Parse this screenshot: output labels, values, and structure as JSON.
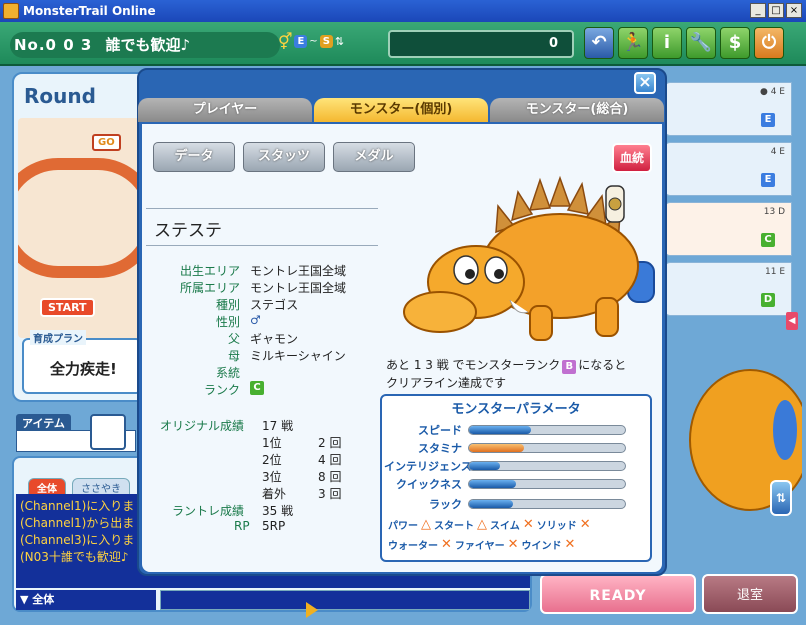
{
  "window": {
    "title": "MonsterTrail Online",
    "min_label": "_",
    "max_label": "□",
    "close_label": "×"
  },
  "topbar": {
    "room_number": "No.0 0 3",
    "room_name": "誰でも歓迎♪",
    "room_chip_e": "E",
    "room_chip_sep": "~",
    "room_chip_s": "S",
    "points": "0",
    "tool_icons": [
      "back-arrow-icon",
      "runner-icon",
      "info-icon",
      "wrench-icon",
      "money-bag-icon",
      "power-icon"
    ]
  },
  "left": {
    "round_label": "Round",
    "goal_label": "GO",
    "start_label": "START",
    "plan_title": "育成プラン",
    "plan_value": "全力疾走!",
    "item_tab": "アイテム"
  },
  "chat": {
    "tabs": [
      "全体",
      "ささやき"
    ],
    "log": [
      "(Channel1)に入りまし",
      "(Channel1)から出まし",
      "(Channel3)に入りまし",
      "(N03十誰でも歓迎♪"
    ],
    "scope": "全体"
  },
  "right_slots": [
    {
      "badge": "● 4 E",
      "rank": "E"
    },
    {
      "badge": "4 E",
      "rank": "E"
    },
    {
      "badge": "13 D",
      "rank": "C"
    },
    {
      "badge": "11 E",
      "rank": "D"
    }
  ],
  "buttons": {
    "ready": "READY",
    "leave": "退室"
  },
  "modal": {
    "close": "×",
    "tabs": [
      "プレイヤー",
      "モンスター(個別)",
      "モンスター(総合)"
    ],
    "sub_buttons": [
      "データ",
      "スタッツ",
      "メダル"
    ],
    "bloodline": "血統",
    "monster_name": "ステステ",
    "info": [
      {
        "label": "出生エリア",
        "value": "モントレ王国全域"
      },
      {
        "label": "所属エリア",
        "value": "モントレ王国全域"
      },
      {
        "label": "種別",
        "value": "ステゴス"
      },
      {
        "label": "性別",
        "value": "♂"
      },
      {
        "label": "父",
        "value": "ギャモン"
      },
      {
        "label": "母",
        "value": "ミルキーシャイン"
      },
      {
        "label": "系統",
        "value": ""
      },
      {
        "label": "ランク",
        "value": "C"
      }
    ],
    "record": {
      "original_label": "オリジナル成績",
      "original_total": "17 戦",
      "places": [
        {
          "place": "1位",
          "count": "2 回"
        },
        {
          "place": "2位",
          "count": "4 回"
        },
        {
          "place": "3位",
          "count": "8 回"
        },
        {
          "place": "着外",
          "count": "3 回"
        }
      ],
      "rantore_label": "ラントレ成績",
      "rantore_total": "35 戦",
      "rp_label": "RP",
      "rp_value": "5RP"
    },
    "hint_line1_a": "あと 1 3 戦 でモンスターランク",
    "hint_rank": "B",
    "hint_line1_b": "になると",
    "hint_line2": "クリアライン達成です",
    "params_title": "モンスターパラメータ",
    "params": [
      {
        "label": "スピード",
        "value": 0.4,
        "color": "blue"
      },
      {
        "label": "スタミナ",
        "value": 0.35,
        "color": "orange"
      },
      {
        "label": "インテリジェンス",
        "value": 0.2,
        "color": "blue"
      },
      {
        "label": "クイックネス",
        "value": 0.3,
        "color": "blue"
      },
      {
        "label": "ラック",
        "value": 0.28,
        "color": "blue"
      }
    ],
    "affinity_row1": [
      "パワー",
      "△",
      "スタート",
      "△",
      "スイム",
      "✕",
      "ソリッド",
      "✕"
    ],
    "affinity_row2": [
      "ウォーター",
      "✕",
      "ファイヤー",
      "✕",
      "ウインド",
      "✕"
    ]
  }
}
